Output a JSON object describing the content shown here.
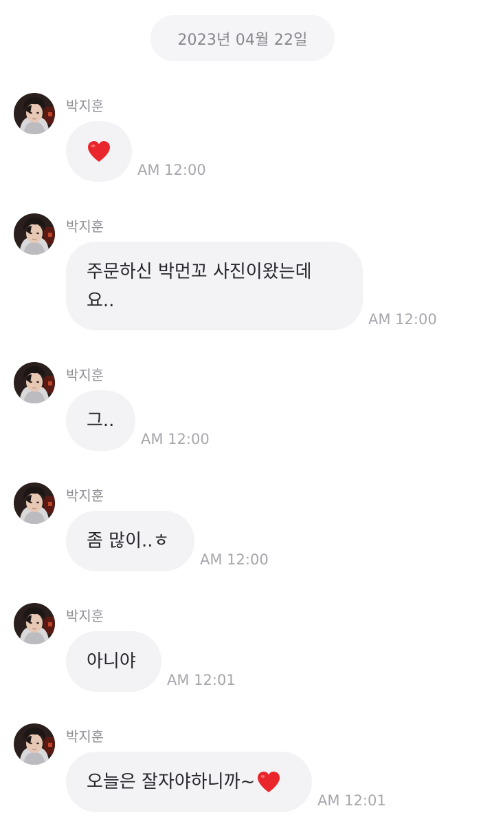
{
  "date_label": "2023년 04월 22일",
  "colors": {
    "bubble": "#f3f3f6",
    "date_pill": "#f5f5f7",
    "heart": "#e8262b"
  },
  "messages": [
    {
      "sender": "박지훈",
      "text": "",
      "icon": "heart-emoji",
      "time": "AM 12:00"
    },
    {
      "sender": "박지훈",
      "text": "주문하신 박먼꼬 사진이왔는데\n요..",
      "time": "AM 12:00"
    },
    {
      "sender": "박지훈",
      "text": "그..",
      "time": "AM 12:00"
    },
    {
      "sender": "박지훈",
      "text": "좀 많이..ㅎ",
      "time": "AM 12:00"
    },
    {
      "sender": "박지훈",
      "text": "아니야",
      "time": "AM 12:01"
    },
    {
      "sender": "박지훈",
      "text": "오늘은 잘자야하니까~",
      "icon": "heart-emoji",
      "time": "AM 12:01"
    }
  ]
}
